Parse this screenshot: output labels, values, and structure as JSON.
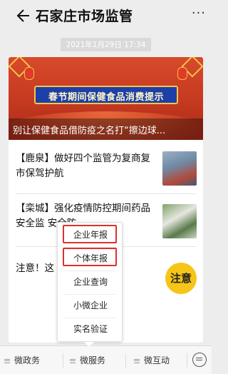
{
  "header": {
    "title": "石家庄市场监管",
    "more_glyph": "···"
  },
  "timestamp": "2021年1月29日 17:34",
  "banner": {
    "headline": "春节期间保健食品消费提示",
    "caption": "别让保健食品借防疫之名打“擦边球..."
  },
  "articles": [
    {
      "text": "【鹿泉】做好四个监管为复商复市保驾护航"
    },
    {
      "text": "【栾城】强化疫情防控期间药品安全监 安全防..."
    },
    {
      "text": "注意！这 “越消越毒”",
      "badge": "注意"
    }
  ],
  "popup_menu": {
    "items": [
      "企业年报",
      "个体年报",
      "企业查询",
      "小微企业",
      "实名验证"
    ]
  },
  "bottom_tabs": [
    "微政务",
    "微服务",
    "微互动"
  ],
  "colors": {
    "highlight": "#e0302a",
    "badge": "#f5c518",
    "banner_title_bg": "#1d3fa8"
  }
}
